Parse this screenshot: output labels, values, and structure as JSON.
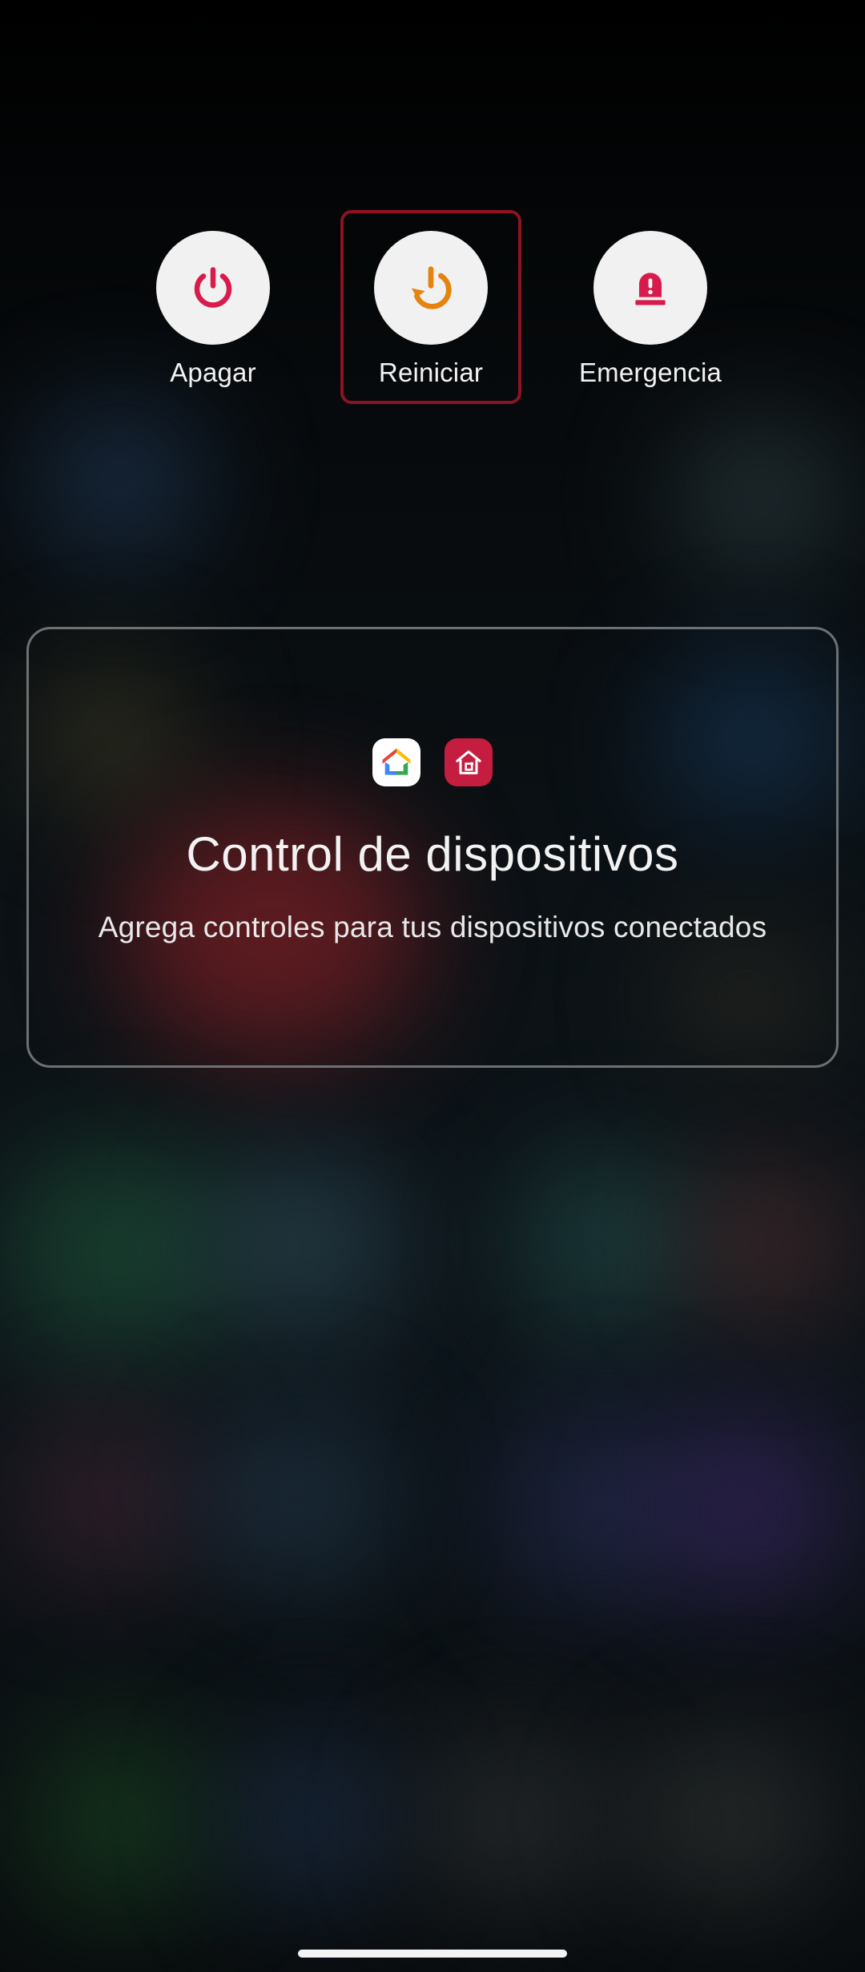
{
  "power_menu": {
    "items": [
      {
        "label": "Apagar",
        "icon": "power-icon",
        "icon_color": "#d81b4b"
      },
      {
        "label": "Reiniciar",
        "icon": "restart-icon",
        "icon_color": "#e5830f",
        "selected": true
      },
      {
        "label": "Emergencia",
        "icon": "emergency-siren-icon",
        "icon_color": "#d81b4b"
      }
    ],
    "selection_border_color": "#8c1224"
  },
  "device_controls": {
    "app_icons": [
      "google-home-icon",
      "smartthings-icon"
    ],
    "title": "Control de dispositivos",
    "subtitle": "Agrega controles para tus dispositivos conectados"
  },
  "colors": {
    "circle_bg": "#f1f1f1",
    "text": "#f2f2f2",
    "card_border": "#6d7173"
  }
}
